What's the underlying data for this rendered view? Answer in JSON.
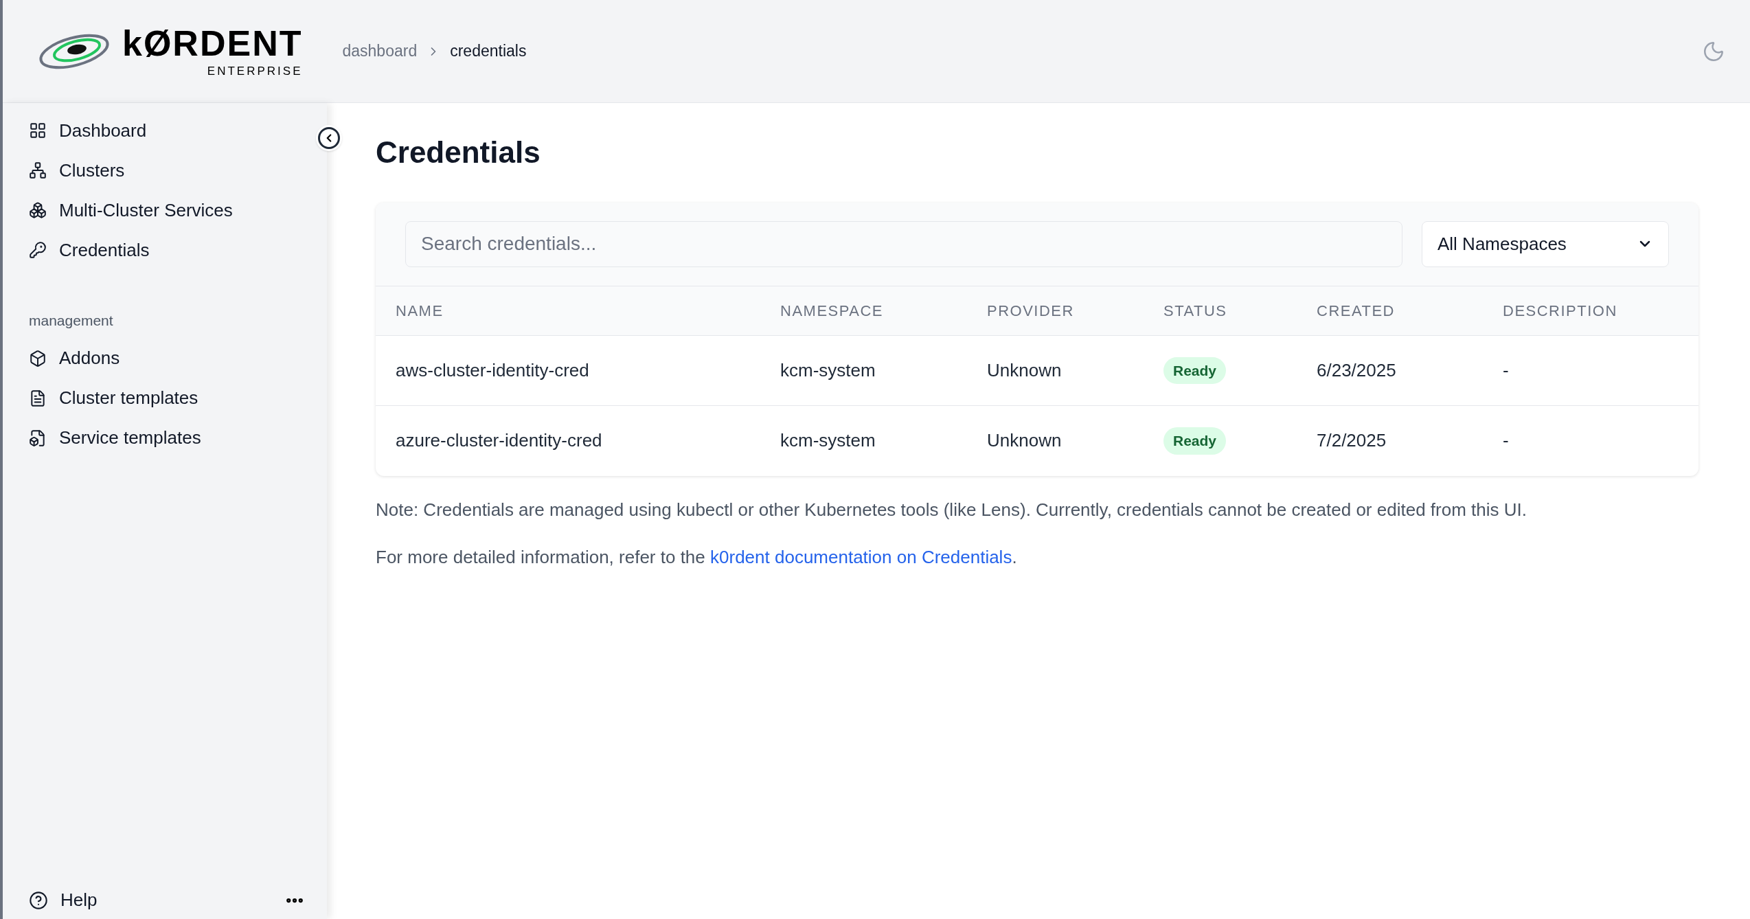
{
  "header": {
    "logo": {
      "wordmark": "kØRDENT",
      "tagline": "ENTERPRISE"
    },
    "breadcrumb": [
      "dashboard",
      "credentials"
    ]
  },
  "sidebar": {
    "items": [
      {
        "label": "Dashboard",
        "kind": "grid",
        "selected": false
      },
      {
        "label": "Clusters",
        "kind": "network",
        "selected": false
      },
      {
        "label": "Multi-Cluster Services",
        "kind": "boxes",
        "selected": false
      },
      {
        "label": "Credentials",
        "kind": "key",
        "selected": false
      }
    ],
    "section_title": "management",
    "management_items": [
      {
        "label": "Addons",
        "kind": "box",
        "selected": false
      },
      {
        "label": "Cluster templates",
        "kind": "file",
        "selected": false
      },
      {
        "label": "Service templates",
        "kind": "filebox",
        "selected": false
      }
    ],
    "help": "Help"
  },
  "page": {
    "title": "Credentials",
    "search": {
      "placeholder": "Search credentials..."
    },
    "namespace_select": "All Namespaces",
    "table": {
      "columns": [
        "NAME",
        "NAMESPACE",
        "PROVIDER",
        "STATUS",
        "CREATED",
        "DESCRIPTION"
      ],
      "rows": [
        [
          "aws-cluster-identity-cred",
          "kcm-system",
          "Unknown",
          "Ready",
          "6/23/2025",
          "-"
        ],
        [
          "azure-cluster-identity-cred",
          "kcm-system",
          "Unknown",
          "Ready",
          "7/2/2025",
          "-"
        ]
      ]
    },
    "note": "Note: Credentials are managed using kubectl or other Kubernetes tools (like Lens). Currently, credentials cannot be created or edited from this UI.",
    "info": {
      "text": "For more detailed information, refer to the ",
      "link": "k0rdent documentation on Credentials",
      "end": "."
    }
  }
}
